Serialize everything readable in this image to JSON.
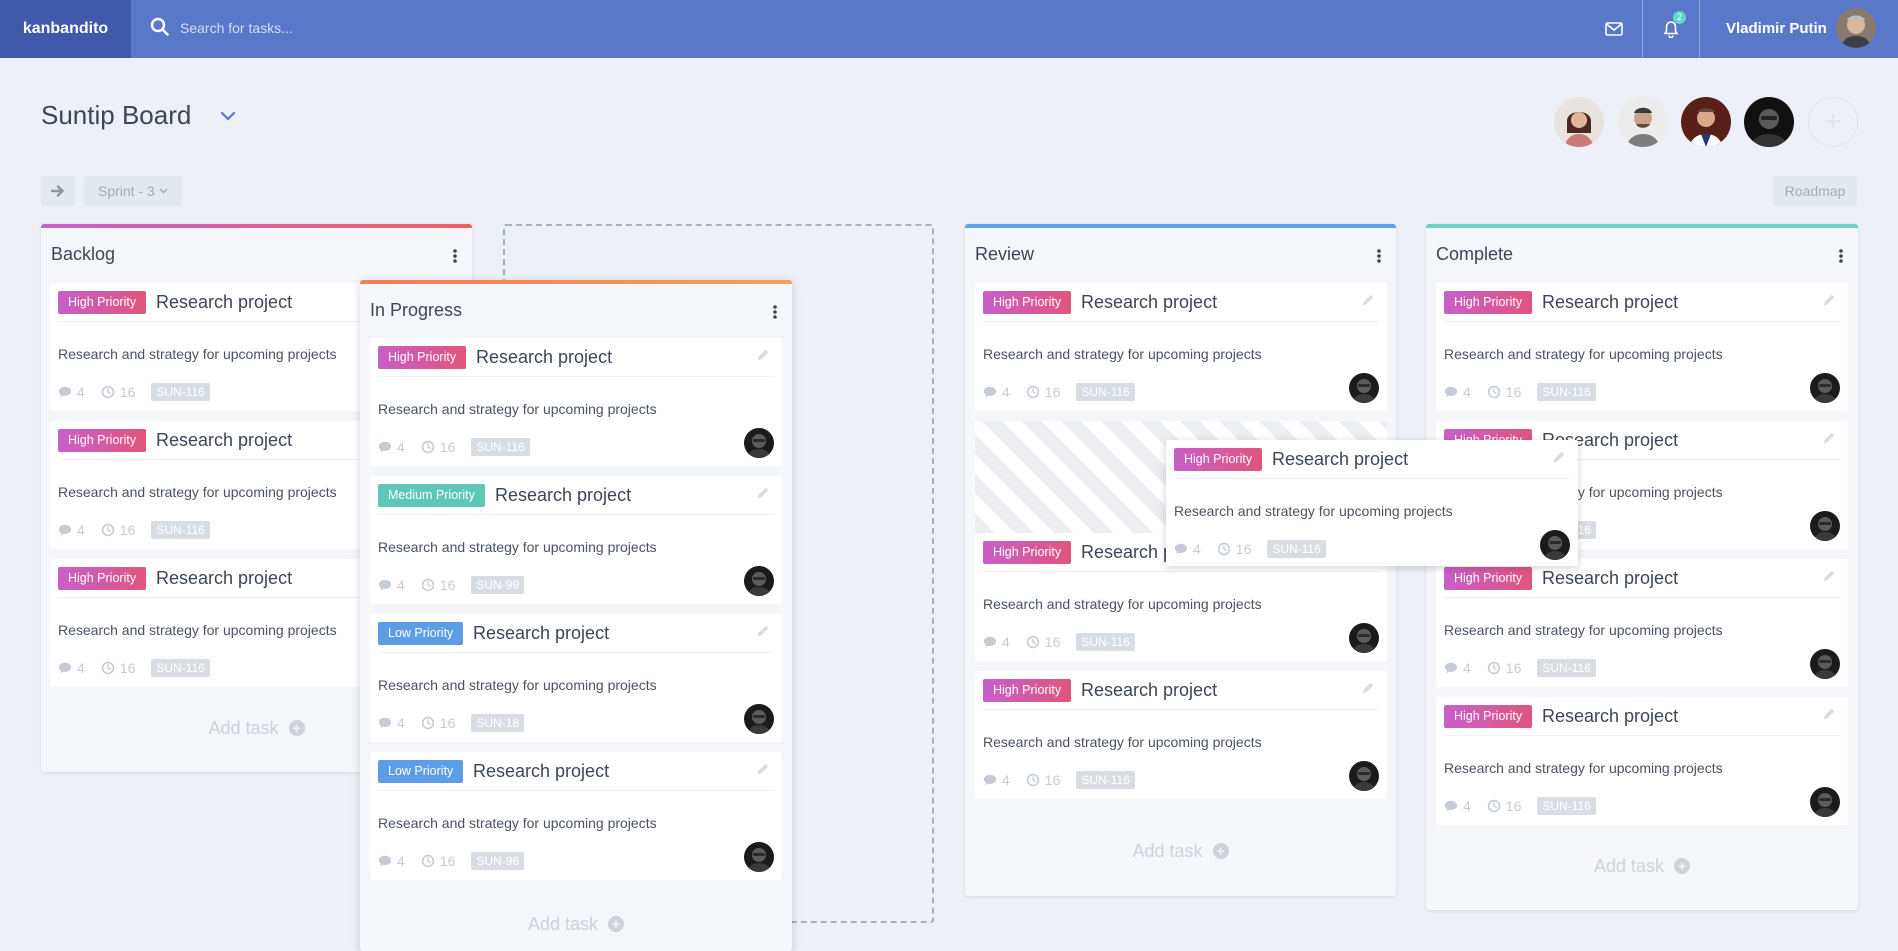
{
  "app": {
    "brand": "kanbandito",
    "search_placeholder": "Search for tasks...",
    "notification_count": "2",
    "user_name": "Vladimir Putin"
  },
  "board": {
    "title": "Suntip Board",
    "sprint_label": "Sprint - 3",
    "roadmap_label": "Roadmap"
  },
  "colors": {
    "topbar": "#5a78c9",
    "brand_bg": "#4059ab",
    "high_priority": "#d45aa7",
    "medium_priority": "#5ec7b8",
    "low_priority": "#5d9de6"
  },
  "columns": [
    {
      "title": "Backlog",
      "add_label": "Add task",
      "cards": [
        {
          "tag": "High Priority",
          "priority": "high",
          "title": "Research project",
          "desc": "Research and strategy for upcoming projects",
          "comments": "4",
          "time": "16",
          "code": "SUN-116"
        },
        {
          "tag": "High Priority",
          "priority": "high",
          "title": "Research project",
          "desc": "Research and strategy for upcoming projects",
          "comments": "4",
          "time": "16",
          "code": "SUN-116"
        },
        {
          "tag": "High Priority",
          "priority": "high",
          "title": "Research project",
          "desc": "Research and strategy for upcoming projects",
          "comments": "4",
          "time": "16",
          "code": "SUN-116"
        }
      ]
    },
    {
      "title": "In Progress",
      "add_label": "Add task",
      "cards": [
        {
          "tag": "High Priority",
          "priority": "high",
          "title": "Research project",
          "desc": "Research and strategy for upcoming projects",
          "comments": "4",
          "time": "16",
          "code": "SUN-116"
        },
        {
          "tag": "Medium Priority",
          "priority": "medium",
          "title": "Research project",
          "desc": "Research and strategy for upcoming projects",
          "comments": "4",
          "time": "16",
          "code": "SUN-99"
        },
        {
          "tag": "Low Priority",
          "priority": "low",
          "title": "Research project",
          "desc": "Research and strategy for upcoming projects",
          "comments": "4",
          "time": "16",
          "code": "SUN-18"
        },
        {
          "tag": "Low Priority",
          "priority": "low",
          "title": "Research project",
          "desc": "Research and strategy for upcoming projects",
          "comments": "4",
          "time": "16",
          "code": "SUN-96"
        }
      ]
    },
    {
      "title": "Review",
      "add_label": "Add task",
      "cards": [
        {
          "tag": "High Priority",
          "priority": "high",
          "title": "Research project",
          "desc": "Research and strategy for upcoming projects",
          "comments": "4",
          "time": "16",
          "code": "SUN-116"
        },
        {
          "tag": "High Priority",
          "priority": "high",
          "title": "Research project",
          "desc": "Research and strategy for upcoming projects",
          "comments": "4",
          "time": "16",
          "code": "SUN-116"
        },
        {
          "tag": "High Priority",
          "priority": "high",
          "title": "Research project",
          "desc": "Research and strategy for upcoming projects",
          "comments": "4",
          "time": "16",
          "code": "SUN-116"
        }
      ]
    },
    {
      "title": "Complete",
      "add_label": "Add task",
      "cards": [
        {
          "tag": "High Priority",
          "priority": "high",
          "title": "Research project",
          "desc": "Research and strategy for upcoming projects",
          "comments": "4",
          "time": "16",
          "code": "SUN-116"
        },
        {
          "tag": "High Priority",
          "priority": "high",
          "title": "Research project",
          "desc": "Research and strategy for upcoming projects",
          "comments": "4",
          "time": "16",
          "code": "SUN-116"
        },
        {
          "tag": "High Priority",
          "priority": "high",
          "title": "Research project",
          "desc": "Research and strategy for upcoming projects",
          "comments": "4",
          "time": "16",
          "code": "SUN-116"
        },
        {
          "tag": "High Priority",
          "priority": "high",
          "title": "Research project",
          "desc": "Research and strategy for upcoming projects",
          "comments": "4",
          "time": "16",
          "code": "SUN-116"
        }
      ]
    }
  ],
  "dragging_card": {
    "tag": "High Priority",
    "priority": "high",
    "title": "Research project",
    "desc": "Research and strategy for upcoming projects",
    "comments": "4",
    "time": "16",
    "code": "SUN-116"
  }
}
